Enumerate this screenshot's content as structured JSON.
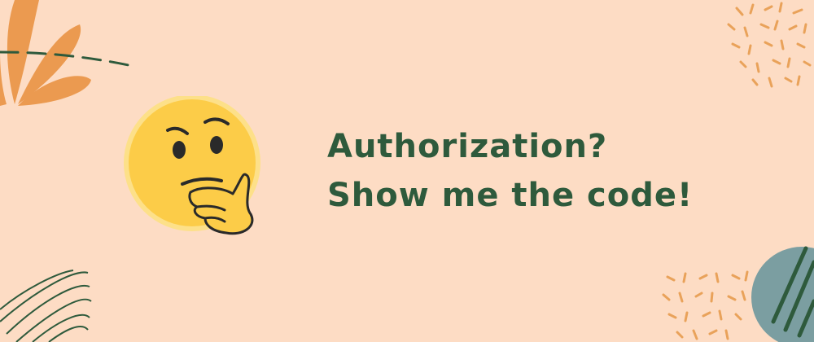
{
  "banner": {
    "headline": {
      "line1": "Authorization?",
      "line2": "Show me the code!"
    },
    "emoji": "thinking-face-icon",
    "colors": {
      "background": "#fddcc4",
      "text": "#2e5a3c",
      "leaf": "#eb9a50",
      "dash": "#2e5a3c",
      "confetti": "#e9a25a",
      "circle": "#7b9ea1",
      "emoji_face": "#fccc48",
      "emoji_glow": "#fde089"
    }
  }
}
